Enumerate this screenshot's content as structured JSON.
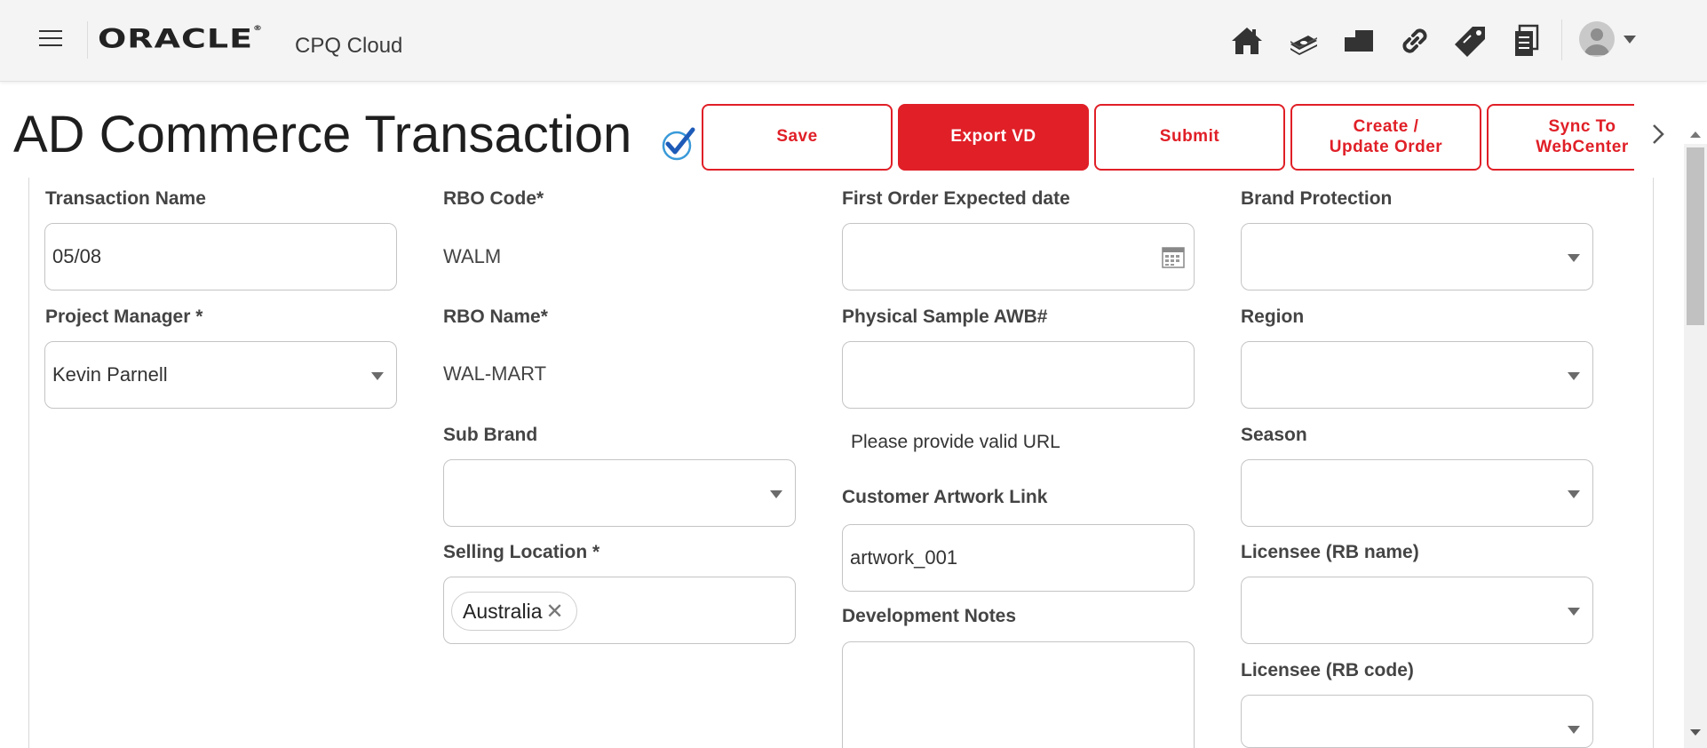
{
  "header": {
    "logo_text": "ORACLE",
    "logo_mark": "®",
    "product": "CPQ Cloud",
    "nav_icons": [
      "home-icon",
      "money-icon",
      "stacked-boxes-icon",
      "link-icon",
      "tag-icon",
      "documents-icon"
    ]
  },
  "page": {
    "title": "AD Commerce Transaction"
  },
  "actions": [
    {
      "label": "Save",
      "primary": false
    },
    {
      "label": "Export VD",
      "primary": true
    },
    {
      "label": "Submit",
      "primary": false
    },
    {
      "label": "Create /\nUpdate Order",
      "primary": false
    },
    {
      "label": "Sync To\nWebCenter",
      "primary": false
    }
  ],
  "form": {
    "transaction_name": {
      "label": "Transaction Name",
      "value": "05/08"
    },
    "project_manager": {
      "label": "Project Manager *",
      "value": "Kevin Parnell"
    },
    "rbo_code": {
      "label": "RBO Code*",
      "value": "WALM"
    },
    "rbo_name": {
      "label": "RBO Name*",
      "value": "WAL-MART"
    },
    "sub_brand": {
      "label": "Sub Brand",
      "value": ""
    },
    "selling_location": {
      "label": "Selling Location *",
      "chip": "Australia",
      "chip_remove": "✕"
    },
    "first_order_date": {
      "label": "First Order Expected date",
      "value": ""
    },
    "physical_sample_awb": {
      "label": "Physical Sample AWB#",
      "value": ""
    },
    "url_helper": "Please provide valid URL",
    "customer_artwork_link": {
      "label": "Customer Artwork Link",
      "value": "artwork_001"
    },
    "development_notes": {
      "label": "Development Notes",
      "value": ""
    },
    "brand_protection": {
      "label": "Brand Protection",
      "value": ""
    },
    "region": {
      "label": "Region",
      "value": ""
    },
    "season": {
      "label": "Season",
      "value": ""
    },
    "licensee_rb_name": {
      "label": "Licensee (RB name)",
      "value": ""
    },
    "licensee_rb_code": {
      "label": "Licensee (RB code)",
      "value": ""
    }
  },
  "colors": {
    "accent": "#e01f27",
    "check_blue": "#1e5bb8"
  }
}
